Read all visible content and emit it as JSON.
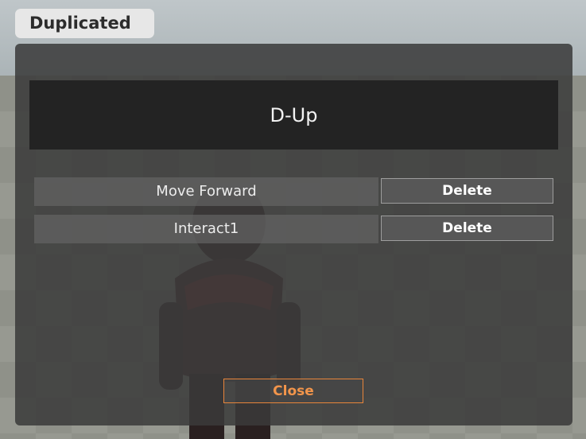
{
  "tag": {
    "label": "Duplicated"
  },
  "dialog": {
    "title": "D-Up",
    "rows": [
      {
        "action": "Move Forward",
        "delete_label": "Delete"
      },
      {
        "action": "Interact1",
        "delete_label": "Delete"
      }
    ],
    "close_label": "Close"
  },
  "colors": {
    "panel": "#3a3a3a",
    "title_bg": "#232323",
    "close_accent": "#e8853a",
    "tag_bg": "#e7e7e7"
  }
}
